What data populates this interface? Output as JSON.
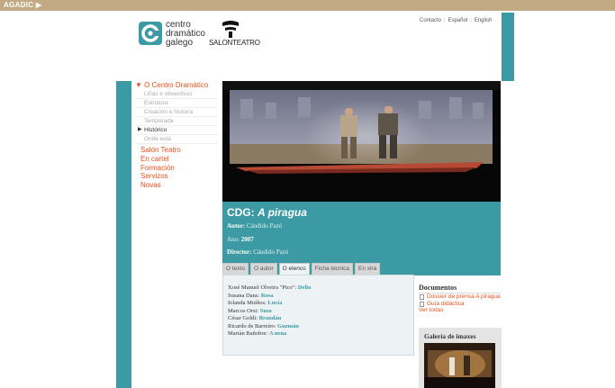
{
  "topbar": {
    "label": "AGADIC ▶"
  },
  "logo": {
    "cdg_lines": [
      "centro",
      "dramático",
      "galego"
    ],
    "salon": "SALONTEATRO"
  },
  "toplinks": [
    "Contacto",
    "Español",
    "English"
  ],
  "nav": {
    "main": "▼ O Centro Dramático",
    "subs": [
      "Liñas e obxectivos",
      "Estrutura",
      "Creación e historia",
      "Temporada",
      "Histórico",
      "Onde está"
    ],
    "active_sub_marker": "▶",
    "sections": [
      "Salón Teatro",
      "En cartel",
      "Formación",
      "Servizos",
      "Novas"
    ]
  },
  "production": {
    "title_prefix": "CDG:",
    "title_name": "A piragua",
    "author_label": "Autor:",
    "author": "Cándido Pazó",
    "year_label": "Ano:",
    "year": "2007",
    "director_label": "Director:",
    "director": "Cándido Pazó"
  },
  "tabs": [
    "O texto",
    "O autor",
    "O elenco",
    "Ficha técnica",
    "En xira"
  ],
  "cast": [
    {
      "actor": "Xosé Manuel Olveira \"Pico\":",
      "role": "Delio"
    },
    {
      "actor": "Susana Dans:",
      "role": "Rosa"
    },
    {
      "actor": "Iolanda Muíños:",
      "role": "Lucía"
    },
    {
      "actor": "Marcos Orsi:",
      "role": "Suso"
    },
    {
      "actor": "César Goldi:",
      "role": "Brandán"
    },
    {
      "actor": "Ricardo de Barreiro:",
      "role": "Guzmán"
    },
    {
      "actor": "Marián Bañobre:",
      "role": "A nena"
    }
  ],
  "docs": {
    "heading": "Documentos",
    "items": [
      "Dossier de prensa A piragua",
      "Guía didáctica"
    ],
    "see_all": "Ver todas"
  },
  "gallery": {
    "heading": "Galería de imaxes"
  },
  "colors": {
    "teal": "#3b9aa3",
    "orange": "#e8521e",
    "topbar": "#c2aa84"
  }
}
